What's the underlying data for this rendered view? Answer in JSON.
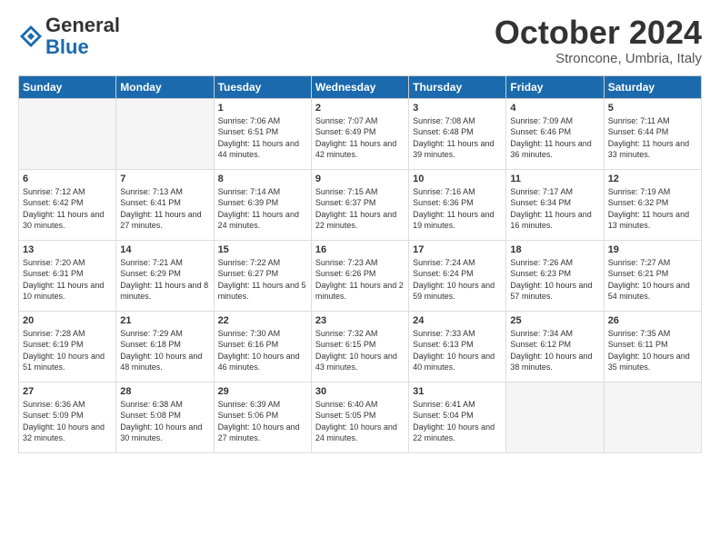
{
  "header": {
    "logo_general": "General",
    "logo_blue": "Blue",
    "month_title": "October 2024",
    "subtitle": "Stroncone, Umbria, Italy"
  },
  "calendar": {
    "days_of_week": [
      "Sunday",
      "Monday",
      "Tuesday",
      "Wednesday",
      "Thursday",
      "Friday",
      "Saturday"
    ],
    "weeks": [
      [
        {
          "day": "",
          "empty": true
        },
        {
          "day": "",
          "empty": true
        },
        {
          "day": "1",
          "sunrise": "Sunrise: 7:06 AM",
          "sunset": "Sunset: 6:51 PM",
          "daylight": "Daylight: 11 hours and 44 minutes."
        },
        {
          "day": "2",
          "sunrise": "Sunrise: 7:07 AM",
          "sunset": "Sunset: 6:49 PM",
          "daylight": "Daylight: 11 hours and 42 minutes."
        },
        {
          "day": "3",
          "sunrise": "Sunrise: 7:08 AM",
          "sunset": "Sunset: 6:48 PM",
          "daylight": "Daylight: 11 hours and 39 minutes."
        },
        {
          "day": "4",
          "sunrise": "Sunrise: 7:09 AM",
          "sunset": "Sunset: 6:46 PM",
          "daylight": "Daylight: 11 hours and 36 minutes."
        },
        {
          "day": "5",
          "sunrise": "Sunrise: 7:11 AM",
          "sunset": "Sunset: 6:44 PM",
          "daylight": "Daylight: 11 hours and 33 minutes."
        }
      ],
      [
        {
          "day": "6",
          "sunrise": "Sunrise: 7:12 AM",
          "sunset": "Sunset: 6:42 PM",
          "daylight": "Daylight: 11 hours and 30 minutes."
        },
        {
          "day": "7",
          "sunrise": "Sunrise: 7:13 AM",
          "sunset": "Sunset: 6:41 PM",
          "daylight": "Daylight: 11 hours and 27 minutes."
        },
        {
          "day": "8",
          "sunrise": "Sunrise: 7:14 AM",
          "sunset": "Sunset: 6:39 PM",
          "daylight": "Daylight: 11 hours and 24 minutes."
        },
        {
          "day": "9",
          "sunrise": "Sunrise: 7:15 AM",
          "sunset": "Sunset: 6:37 PM",
          "daylight": "Daylight: 11 hours and 22 minutes."
        },
        {
          "day": "10",
          "sunrise": "Sunrise: 7:16 AM",
          "sunset": "Sunset: 6:36 PM",
          "daylight": "Daylight: 11 hours and 19 minutes."
        },
        {
          "day": "11",
          "sunrise": "Sunrise: 7:17 AM",
          "sunset": "Sunset: 6:34 PM",
          "daylight": "Daylight: 11 hours and 16 minutes."
        },
        {
          "day": "12",
          "sunrise": "Sunrise: 7:19 AM",
          "sunset": "Sunset: 6:32 PM",
          "daylight": "Daylight: 11 hours and 13 minutes."
        }
      ],
      [
        {
          "day": "13",
          "sunrise": "Sunrise: 7:20 AM",
          "sunset": "Sunset: 6:31 PM",
          "daylight": "Daylight: 11 hours and 10 minutes."
        },
        {
          "day": "14",
          "sunrise": "Sunrise: 7:21 AM",
          "sunset": "Sunset: 6:29 PM",
          "daylight": "Daylight: 11 hours and 8 minutes."
        },
        {
          "day": "15",
          "sunrise": "Sunrise: 7:22 AM",
          "sunset": "Sunset: 6:27 PM",
          "daylight": "Daylight: 11 hours and 5 minutes."
        },
        {
          "day": "16",
          "sunrise": "Sunrise: 7:23 AM",
          "sunset": "Sunset: 6:26 PM",
          "daylight": "Daylight: 11 hours and 2 minutes."
        },
        {
          "day": "17",
          "sunrise": "Sunrise: 7:24 AM",
          "sunset": "Sunset: 6:24 PM",
          "daylight": "Daylight: 10 hours and 59 minutes."
        },
        {
          "day": "18",
          "sunrise": "Sunrise: 7:26 AM",
          "sunset": "Sunset: 6:23 PM",
          "daylight": "Daylight: 10 hours and 57 minutes."
        },
        {
          "day": "19",
          "sunrise": "Sunrise: 7:27 AM",
          "sunset": "Sunset: 6:21 PM",
          "daylight": "Daylight: 10 hours and 54 minutes."
        }
      ],
      [
        {
          "day": "20",
          "sunrise": "Sunrise: 7:28 AM",
          "sunset": "Sunset: 6:19 PM",
          "daylight": "Daylight: 10 hours and 51 minutes."
        },
        {
          "day": "21",
          "sunrise": "Sunrise: 7:29 AM",
          "sunset": "Sunset: 6:18 PM",
          "daylight": "Daylight: 10 hours and 48 minutes."
        },
        {
          "day": "22",
          "sunrise": "Sunrise: 7:30 AM",
          "sunset": "Sunset: 6:16 PM",
          "daylight": "Daylight: 10 hours and 46 minutes."
        },
        {
          "day": "23",
          "sunrise": "Sunrise: 7:32 AM",
          "sunset": "Sunset: 6:15 PM",
          "daylight": "Daylight: 10 hours and 43 minutes."
        },
        {
          "day": "24",
          "sunrise": "Sunrise: 7:33 AM",
          "sunset": "Sunset: 6:13 PM",
          "daylight": "Daylight: 10 hours and 40 minutes."
        },
        {
          "day": "25",
          "sunrise": "Sunrise: 7:34 AM",
          "sunset": "Sunset: 6:12 PM",
          "daylight": "Daylight: 10 hours and 38 minutes."
        },
        {
          "day": "26",
          "sunrise": "Sunrise: 7:35 AM",
          "sunset": "Sunset: 6:11 PM",
          "daylight": "Daylight: 10 hours and 35 minutes."
        }
      ],
      [
        {
          "day": "27",
          "sunrise": "Sunrise: 6:36 AM",
          "sunset": "Sunset: 5:09 PM",
          "daylight": "Daylight: 10 hours and 32 minutes."
        },
        {
          "day": "28",
          "sunrise": "Sunrise: 6:38 AM",
          "sunset": "Sunset: 5:08 PM",
          "daylight": "Daylight: 10 hours and 30 minutes."
        },
        {
          "day": "29",
          "sunrise": "Sunrise: 6:39 AM",
          "sunset": "Sunset: 5:06 PM",
          "daylight": "Daylight: 10 hours and 27 minutes."
        },
        {
          "day": "30",
          "sunrise": "Sunrise: 6:40 AM",
          "sunset": "Sunset: 5:05 PM",
          "daylight": "Daylight: 10 hours and 24 minutes."
        },
        {
          "day": "31",
          "sunrise": "Sunrise: 6:41 AM",
          "sunset": "Sunset: 5:04 PM",
          "daylight": "Daylight: 10 hours and 22 minutes."
        },
        {
          "day": "",
          "empty": true
        },
        {
          "day": "",
          "empty": true
        }
      ]
    ]
  }
}
